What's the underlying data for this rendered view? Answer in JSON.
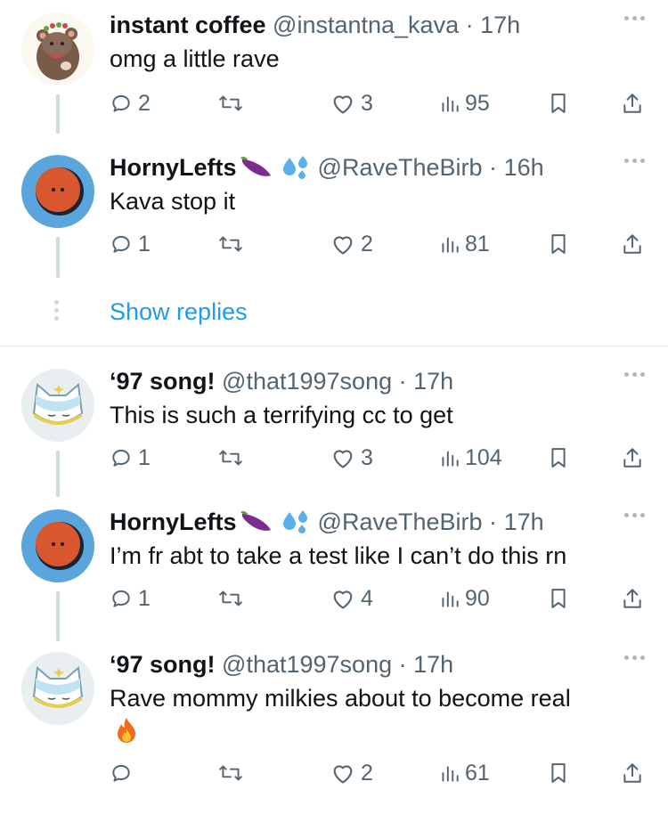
{
  "tweets": [
    {
      "name": "instant coffee",
      "handle": "@instantna_kava",
      "time": "17h",
      "text": "omg a little rave",
      "reply_count": "2",
      "like_count": "3",
      "view_count": "95"
    },
    {
      "name": "HornyLefts",
      "handle": "@RaveTheBirb",
      "time": "16h",
      "text": "Kava stop it",
      "reply_count": "1",
      "like_count": "2",
      "view_count": "81"
    },
    {
      "name": "‘97 song!",
      "handle": "@that1997song",
      "time": "17h",
      "text": "This is such a terrifying cc to get",
      "reply_count": "1",
      "like_count": "3",
      "view_count": "104"
    },
    {
      "name": "HornyLefts",
      "handle": "@RaveTheBirb",
      "time": "17h",
      "text": "I’m fr abt to take a test like I can’t do this rn",
      "reply_count": "1",
      "like_count": "4",
      "view_count": "90"
    },
    {
      "name": "‘97 song!",
      "handle": "@that1997song",
      "time": "17h",
      "text": "Rave mommy milkies about to become real",
      "reply_count": "",
      "like_count": "2",
      "view_count": "61"
    }
  ],
  "show_replies_label": "Show replies",
  "separator": "·",
  "icons": {
    "reply": "reply-icon",
    "retweet": "retweet-icon",
    "like": "heart-icon",
    "views": "views-icon",
    "bookmark": "bookmark-icon",
    "share": "share-icon",
    "more": "more-icon",
    "eggplant": "eggplant-emoji-icon",
    "sweat": "sweat-droplets-emoji-icon",
    "fire": "fire-emoji-icon"
  },
  "colors": {
    "link": "#1d9bf0",
    "secondary": "#536471",
    "thread_line": "#cfd9de",
    "rave_avatar_bg": "#5aa5dc",
    "rave_avatar_face": "#d9572f"
  }
}
